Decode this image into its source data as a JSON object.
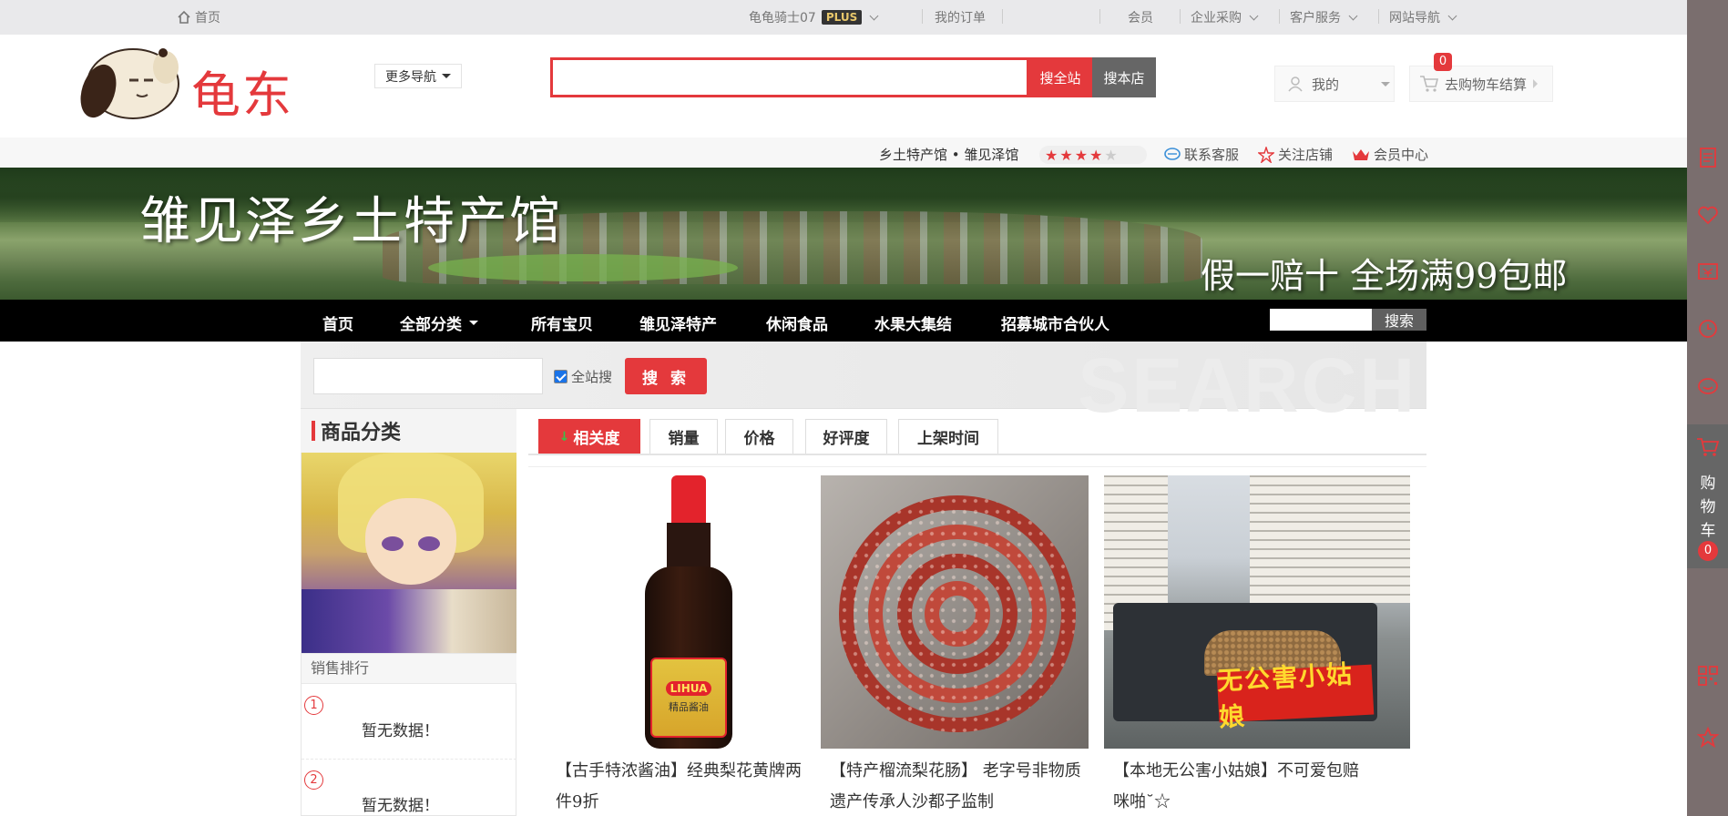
{
  "topbar": {
    "home": "首页",
    "username": "龟龟骑士07",
    "plus_badge": "PLUS",
    "my_orders": "我的订单",
    "member": "会员",
    "enterprise": "企业采购",
    "service": "客户服务",
    "site_nav": "网站导航"
  },
  "header": {
    "logo_text": "龟东",
    "more_nav": "更多导航",
    "search_placeholder": "",
    "search_all": "搜全站",
    "search_store": "搜本店",
    "mine": "我的",
    "cart": "去购物车结算",
    "cart_count": "0"
  },
  "shopbar": {
    "shop_name": "乡土特产馆 • 雏见泽馆",
    "rating": 4,
    "rating_max": 5,
    "contact": "联系客服",
    "follow": "关注店铺",
    "vip": "会员中心"
  },
  "banner": {
    "title": "雏见泽乡土特产馆",
    "slogan": "假一赔十  全场满99包邮"
  },
  "shopnav": {
    "items": [
      "首页",
      "全部分类",
      "所有宝贝",
      "雏见泽特产",
      "休闲食品",
      "水果大集结",
      "招募城市合伙人"
    ],
    "search_button": "搜索"
  },
  "search_strip": {
    "checkbox_label": "全站搜",
    "checked": true,
    "button": "搜 索",
    "watermark": "SEARCH"
  },
  "sidebar": {
    "title": "商品分类",
    "sales_rank_title": "销售排行",
    "ranks": [
      {
        "num": "1",
        "text": "暂无数据！"
      },
      {
        "num": "2",
        "text": "暂无数据！"
      }
    ]
  },
  "sort_tabs": [
    "相关度",
    "销量",
    "价格",
    "好评度",
    "上架时间"
  ],
  "products": [
    {
      "title": "【古手特浓酱油】经典梨花黄牌两件9折",
      "label_brand": "LIHUA",
      "label_text": "精品酱油"
    },
    {
      "title": "【特产榴流梨花肠】 老字号非物质遗产传承人沙都子监制"
    },
    {
      "title": "【本地无公害小姑娘】不可爱包赔咪啪˘☆",
      "banner_text": "无公害小姑娘"
    }
  ],
  "right_sidebar": {
    "cart_label": "购物车",
    "cart_count": "0",
    "icons": [
      "document-icon",
      "heart-icon",
      "coupon-icon",
      "history-icon",
      "service-icon",
      "cart-icon",
      "qrcode-icon",
      "star-icon"
    ]
  },
  "colors": {
    "accent": "#e4393c",
    "nav_bg": "#000000",
    "sidebar_bg": "#7a6e6e"
  }
}
